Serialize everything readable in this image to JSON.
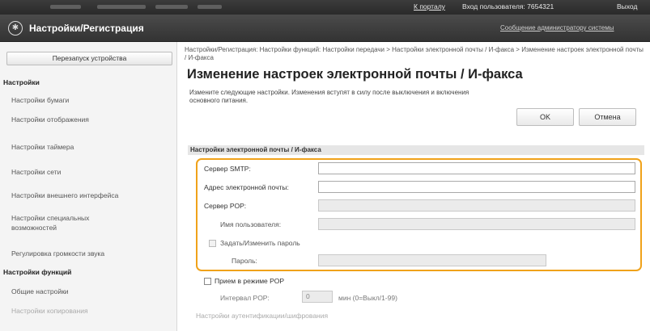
{
  "topbar": {
    "portal_link": "К порталу",
    "user_label": "Вход пользователя: 7654321",
    "logout_label": "Выход"
  },
  "header": {
    "title": "Настройки/Регистрация",
    "admin_message": "Сообщение администратору системы"
  },
  "sidebar": {
    "restart_button": "Перезапуск устройства",
    "section_settings": "Настройки",
    "items": [
      "Настройки бумаги",
      "Настройки отображения",
      "Настройки таймера",
      "Настройки сети",
      "Настройки внешнего интерфейса",
      "Настройки специальных возможностей",
      "Регулировка громкости звука"
    ],
    "section_functions": "Настройки функций",
    "function_items": [
      "Общие настройки",
      "Настройки копирования"
    ]
  },
  "main": {
    "breadcrumb": "Настройки/Регистрация: Настройки функций: Настройки передачи > Настройки электронной почты / И-факса > Изменение настроек электронной почты / И-факса",
    "title": "Изменение настроек электронной почты / И-факса",
    "description": "Измените следующие настройки. Изменения вступят в силу после выключения и включения основного питания.",
    "ok_button": "OK",
    "cancel_button": "Отмена",
    "section_title": "Настройки электронной почты / И-факса",
    "fields": {
      "smtp_label": "Сервер SMTP:",
      "smtp_value": "",
      "email_label": "Адрес электронной почты:",
      "email_value": "",
      "pop_label": "Сервер POP:",
      "pop_value": "",
      "username_label": "Имя пользователя:",
      "username_value": "",
      "set_password_label": "Задать/Изменить пароль",
      "password_label": "Пароль:",
      "password_value": ""
    },
    "pop_receive_label": "Прием в режиме POP",
    "pop_interval_label": "Интервал POP:",
    "pop_interval_value": "0",
    "pop_interval_unit": "мин (0=Выкл/1-99)",
    "auth_section_label": "Настройки аутентификации/шифрования"
  },
  "colors": {
    "highlight_frame": "#f0a21a",
    "header_bg": "#3a3a3a"
  }
}
